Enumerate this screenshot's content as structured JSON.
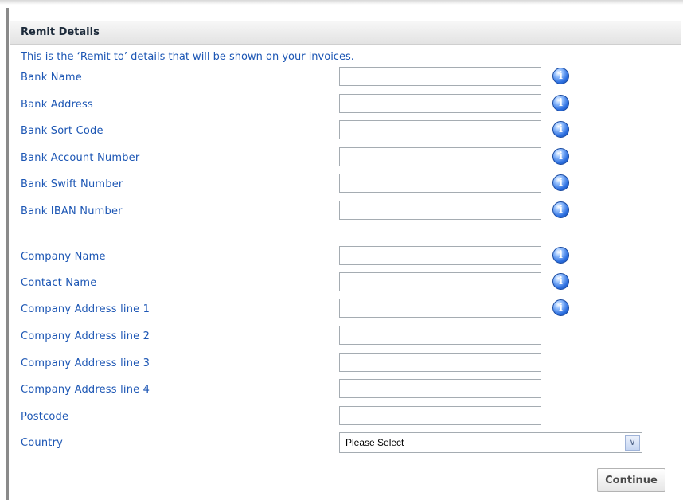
{
  "panel": {
    "title": "Remit Details",
    "intro": "This is the ‘Remit to’ details that will be shown on your invoices."
  },
  "bank_fields": [
    {
      "label": "Bank Name",
      "value": "",
      "info_icon": "info-icon"
    },
    {
      "label": "Bank Address",
      "value": "",
      "info_icon": "info-icon"
    },
    {
      "label": "Bank Sort Code",
      "value": "",
      "info_icon": "info-icon"
    },
    {
      "label": "Bank Account Number",
      "value": "",
      "info_icon": "info-icon"
    },
    {
      "label": "Bank Swift Number",
      "value": "",
      "info_icon": "info-icon"
    },
    {
      "label": "Bank IBAN Number",
      "value": "",
      "info_icon": "info-icon"
    }
  ],
  "company_fields": [
    {
      "label": "Company Name",
      "value": "",
      "info_icon": "info-icon"
    },
    {
      "label": "Contact Name",
      "value": "",
      "info_icon": "info-icon"
    },
    {
      "label": "Company Address line 1",
      "value": "",
      "info_icon": "info-icon"
    },
    {
      "label": "Company Address line 2",
      "value": ""
    },
    {
      "label": "Company Address line 3",
      "value": ""
    },
    {
      "label": "Company Address line 4",
      "value": ""
    },
    {
      "label": "Postcode",
      "value": ""
    }
  ],
  "country": {
    "label": "Country",
    "selected": "Please Select"
  },
  "actions": {
    "continue_label": "Continue"
  },
  "icons": {
    "info": "i",
    "dropdown": "∨"
  }
}
